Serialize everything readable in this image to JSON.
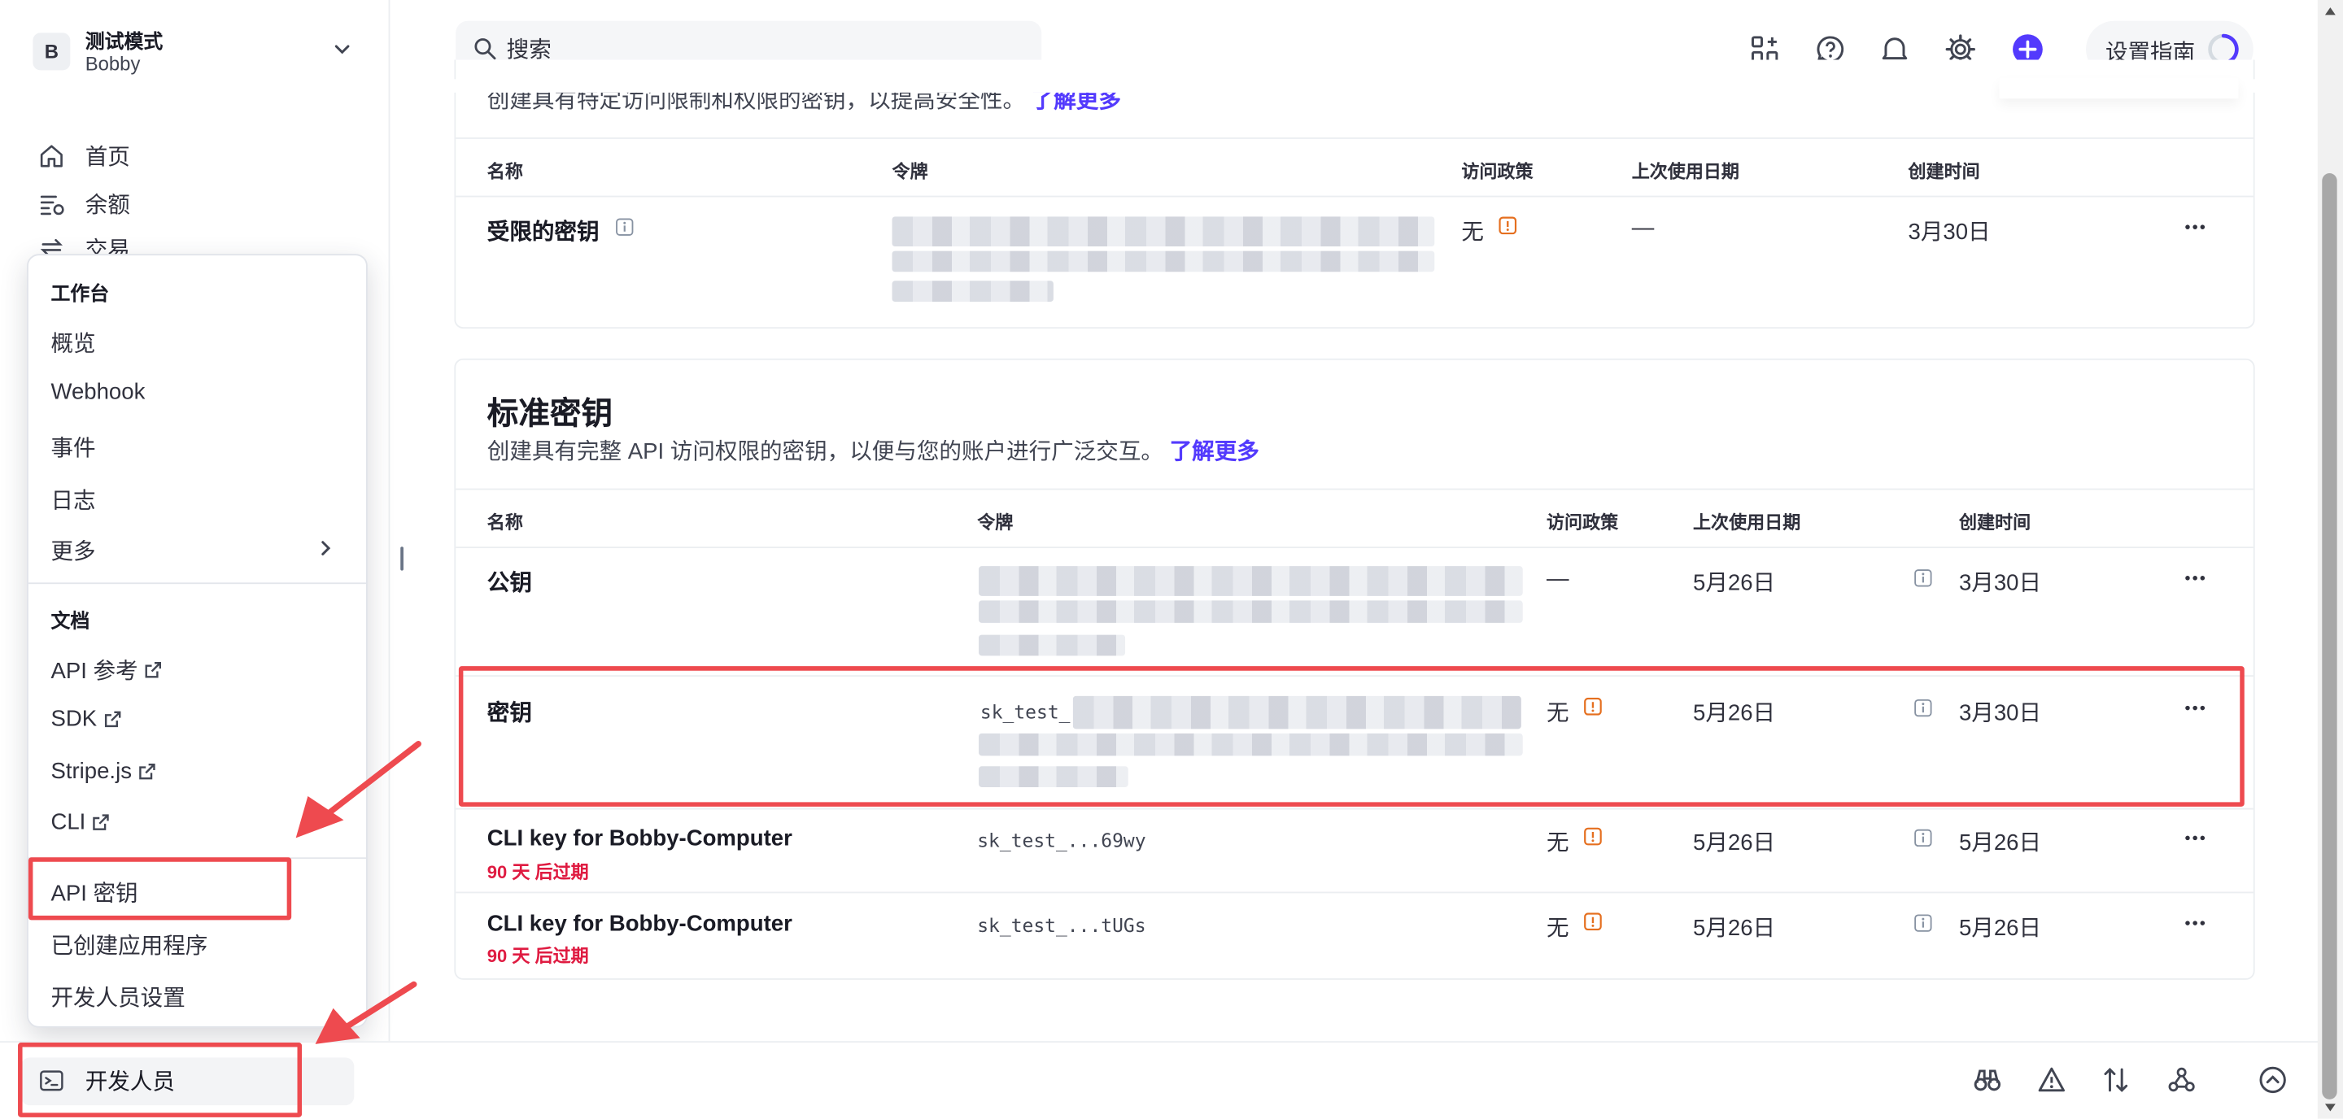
{
  "account": {
    "initial": "B",
    "mode": "测试模式",
    "user": "Bobby"
  },
  "sidebar": {
    "items": [
      {
        "label": "首页",
        "icon": "home-icon"
      },
      {
        "label": "余额",
        "icon": "balance-icon"
      },
      {
        "label": "交易",
        "icon": "transactions-icon"
      }
    ]
  },
  "menu": {
    "workbench_header": "工作台",
    "workbench_items": [
      "概览",
      "Webhook",
      "事件",
      "日志",
      "更多"
    ],
    "docs_header": "文档",
    "docs_items": [
      "API 参考",
      "SDK",
      "Stripe.js",
      "CLI"
    ],
    "bottom_items": [
      "API 密钥",
      "已创建应用程序",
      "开发人员设置"
    ]
  },
  "bottom": {
    "developer_label": "开发人员"
  },
  "search": {
    "placeholder": "搜索"
  },
  "topbar": {
    "guide_label": "设置指南"
  },
  "restricted": {
    "partial_text": "创建具有特定访问限制和权限的密钥，以提高安全性。",
    "partial_link": "了解更多",
    "headers": {
      "name": "名称",
      "token": "令牌",
      "policy": "访问政策",
      "last_used": "上次使用日期",
      "created": "创建时间"
    },
    "row": {
      "name": "受限的密钥",
      "policy": "无",
      "last_used": "—",
      "created": "3月30日"
    }
  },
  "standard": {
    "title": "标准密钥",
    "subtitle": "创建具有完整 API 访问权限的密钥，以便与您的账户进行广泛交互。",
    "link": "了解更多",
    "headers": {
      "name": "名称",
      "token": "令牌",
      "policy": "访问政策",
      "last_used": "上次使用日期",
      "created": "创建时间"
    },
    "rows": [
      {
        "name": "公钥",
        "token": "",
        "policy": "—",
        "last_used": "5月26日",
        "created": "3月30日"
      },
      {
        "name": "密钥",
        "token": "sk_test_",
        "policy": "无",
        "last_used": "5月26日",
        "created": "3月30日"
      },
      {
        "name": "CLI key for Bobby-Computer",
        "expire": "90 天 后过期",
        "token": "sk_test_...69wy",
        "policy": "无",
        "last_used": "5月26日",
        "created": "5月26日"
      },
      {
        "name": "CLI key for Bobby-Computer",
        "expire": "90 天 后过期",
        "token": "sk_test_...tUGs",
        "policy": "无",
        "last_used": "5月26日",
        "created": "5月26日"
      }
    ]
  },
  "colors": {
    "accent": "#533afd",
    "highlight": "#ee4a4f",
    "expire": "#df1b41",
    "warn": "#e56f1f"
  }
}
